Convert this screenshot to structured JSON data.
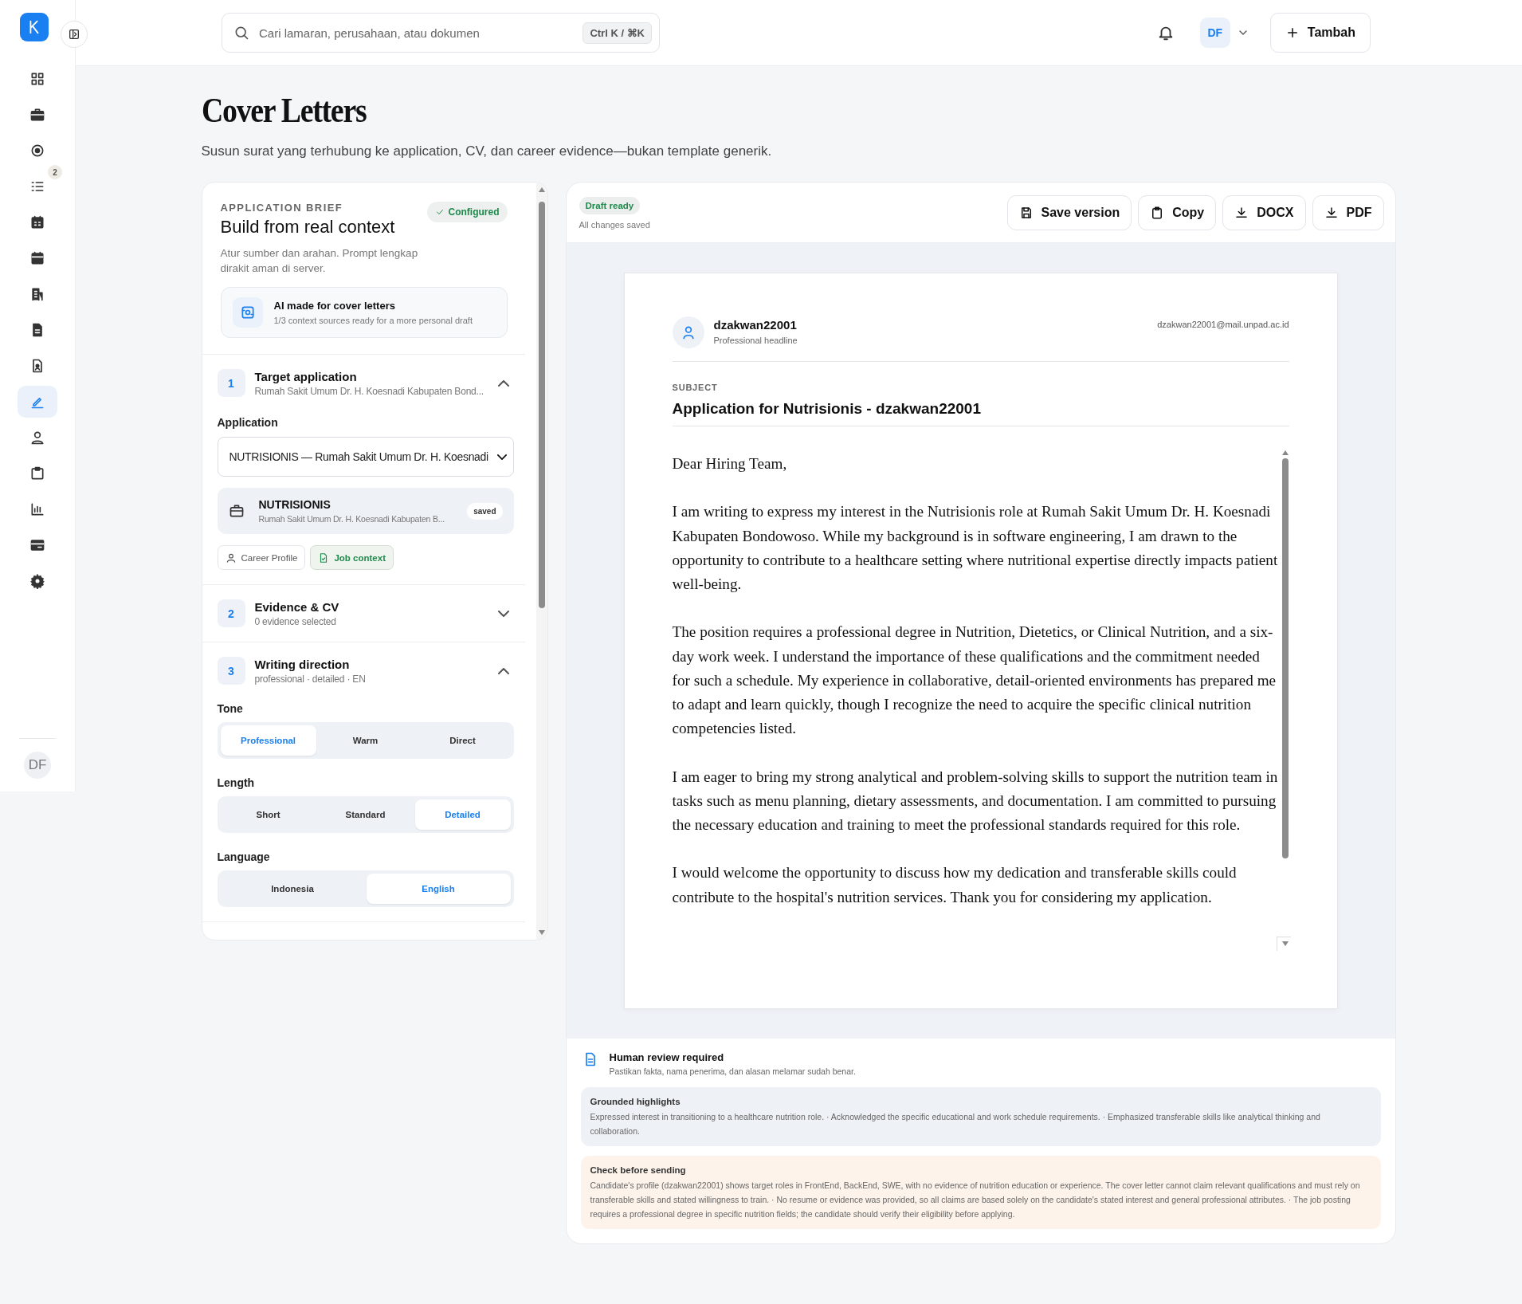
{
  "header": {
    "search_placeholder": "Cari lamaran, perusahaan, atau dokumen",
    "shortcut": "Ctrl K / ⌘K",
    "user_initials": "DF",
    "add_button": "Tambah"
  },
  "sidebar": {
    "items": [
      {
        "selected": false
      },
      {
        "selected": false
      },
      {
        "selected": false
      },
      {
        "selected": false,
        "badge": "2"
      },
      {
        "selected": false
      },
      {
        "selected": false
      },
      {
        "selected": false
      },
      {
        "selected": false
      },
      {
        "selected": false
      },
      {
        "selected": true
      },
      {
        "selected": false
      },
      {
        "selected": false
      },
      {
        "selected": false
      },
      {
        "selected": false
      },
      {
        "selected": false
      }
    ],
    "avatar": "DF"
  },
  "page": {
    "title": "Cover Letters",
    "subtitle": "Susun surat yang terhubung ke application, CV, dan career evidence—bukan template generik."
  },
  "brief": {
    "eyebrow": "APPLICATION BRIEF",
    "status": "Configured",
    "title": "Build from real context",
    "description": "Atur sumber dan arahan. Prompt lengkap dirakit aman di server.",
    "ai_card": {
      "title": "AI made for cover letters",
      "subtitle": "1/3 context sources ready for a more personal draft"
    }
  },
  "steps": [
    {
      "number": "1",
      "title": "Target application",
      "subtitle": "Rumah Sakit Umum Dr. H. Koesnadi Kabupaten Bond...",
      "expanded": true,
      "kind": "application",
      "field_label": "Application",
      "select_value": "NUTRISIONIS — Rumah Sakit Umum Dr. H. Koesnadi",
      "job": {
        "title": "NUTRISIONIS",
        "company": "Rumah Sakit Umum Dr. H. Koesnadi Kabupaten B...",
        "badge": "saved"
      },
      "sources": [
        {
          "label": "Career Profile",
          "ready": false
        },
        {
          "label": "Job context",
          "ready": true
        }
      ]
    },
    {
      "number": "2",
      "title": "Evidence & CV",
      "subtitle": "0 evidence selected",
      "expanded": false
    },
    {
      "number": "3",
      "title": "Writing direction",
      "subtitle": "professional · detailed · EN",
      "expanded": true,
      "kind": "direction",
      "groups": [
        {
          "label": "Tone",
          "options": [
            {
              "label": "Professional",
              "selected": true
            },
            {
              "label": "Warm",
              "selected": false
            },
            {
              "label": "Direct",
              "selected": false
            }
          ]
        },
        {
          "label": "Length",
          "options": [
            {
              "label": "Short",
              "selected": false
            },
            {
              "label": "Standard",
              "selected": false
            },
            {
              "label": "Detailed",
              "selected": true
            }
          ]
        },
        {
          "label": "Language",
          "options": [
            {
              "label": "Indonesia",
              "selected": false
            },
            {
              "label": "English",
              "selected": true
            }
          ]
        }
      ]
    }
  ],
  "editor": {
    "status": "Draft ready",
    "saved_note": "All changes saved",
    "actions": [
      {
        "label": "Save version",
        "kind": "save"
      },
      {
        "label": "Copy",
        "kind": "copy"
      },
      {
        "label": "DOCX",
        "kind": "download"
      },
      {
        "label": "PDF",
        "kind": "download"
      }
    ],
    "letter": {
      "name": "dzakwan22001",
      "headline": "Professional headline",
      "email": "dzakwan22001@mail.unpad.ac.id",
      "subject_label": "SUBJECT",
      "subject": "Application for Nutrisionis - dzakwan22001",
      "body": [
        "Dear Hiring Team,",
        "I am writing to express my interest in the Nutrisionis role at Rumah Sakit Umum Dr. H. Koesnadi Kabupaten Bondowoso. While my background is in software engineering, I am drawn to the opportunity to contribute to a healthcare setting where nutritional expertise directly impacts patient well-being.",
        "The position requires a professional degree in Nutrition, Dietetics, or Clinical Nutrition, and a six-day work week. I understand the importance of these qualifications and the commitment needed for such a schedule. My experience in collaborative, detail-oriented environments has prepared me to adapt and learn quickly, though I recognize the need to acquire the specific clinical nutrition competencies listed.",
        "I am eager to bring my strong analytical and problem-solving skills to support the nutrition team in tasks such as menu planning, dietary assessments, and documentation. I am committed to pursuing the necessary education and training to meet the professional standards required for this role.",
        "I would welcome the opportunity to discuss how my dedication and transferable skills could contribute to the hospital's nutrition services. Thank you for considering my application."
      ]
    }
  },
  "review": {
    "title": "Human review required",
    "note": "Pastikan fakta, nama penerima, dan alasan melamar sudah benar.",
    "panels": [
      {
        "kind": "highlights",
        "title": "Grounded highlights",
        "text": "Expressed interest in transitioning to a healthcare nutrition role. · Acknowledged the specific educational and work schedule requirements. · Emphasized transferable skills like analytical thinking and collaboration."
      },
      {
        "kind": "warning",
        "title": "Check before sending",
        "text": "Candidate's profile (dzakwan22001) shows target roles in FrontEnd, BackEnd, SWE, with no evidence of nutrition education or experience. The cover letter cannot claim relevant qualifications and must rely on transferable skills and stated willingness to train. · No resume or evidence was provided, so all claims are based solely on the candidate's stated interest and general professional attributes. · The job posting requires a professional degree in specific nutrition fields; the candidate should verify their eligibility before applying."
      }
    ]
  }
}
